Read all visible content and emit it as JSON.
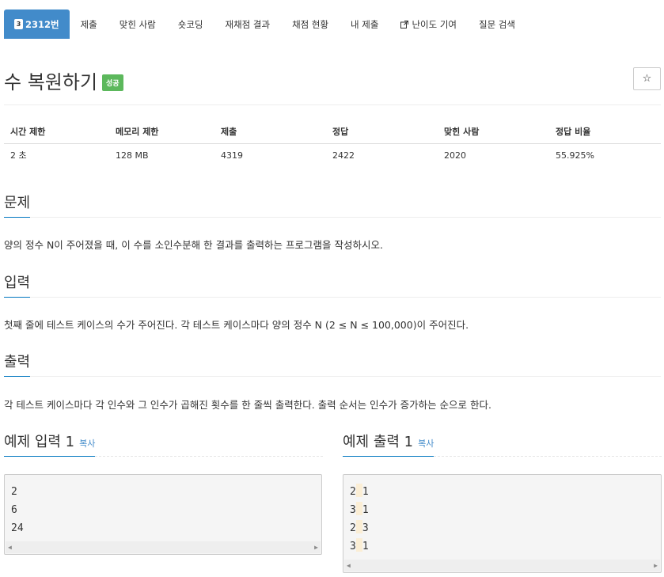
{
  "nav": {
    "problem_number": "2312번",
    "level_badge": "3",
    "tabs": [
      "제출",
      "맞힌 사람",
      "숏코딩",
      "재채점 결과",
      "채점 현황",
      "내 제출",
      "난이도 기여",
      "질문 검색"
    ]
  },
  "title": "수 복원하기",
  "status_badge": "성공",
  "star_label": "☆",
  "info": {
    "headers": [
      "시간 제한",
      "메모리 제한",
      "제출",
      "정답",
      "맞힌 사람",
      "정답 비율"
    ],
    "values": [
      "2 초",
      "128 MB",
      "4319",
      "2422",
      "2020",
      "55.925%"
    ]
  },
  "sections": {
    "problem": {
      "heading": "문제",
      "text": "양의 정수 N이 주어졌을 때, 이 수를 소인수분해 한 결과를 출력하는 프로그램을 작성하시오."
    },
    "input": {
      "heading": "입력",
      "text": "첫째 줄에 테스트 케이스의 수가 주어진다. 각 테스트 케이스마다 양의 정수 N (2 ≤ N ≤ 100,000)이 주어진다."
    },
    "output": {
      "heading": "출력",
      "text": "각 테스트 케이스마다 각 인수와 그 인수가 곱해진 횟수를 한 줄씩 출력한다. 출력 순서는 인수가 증가하는 순으로 한다."
    }
  },
  "samples": {
    "input": {
      "heading": "예제 입력 1",
      "copy": "복사",
      "lines": [
        "2",
        "6",
        "24"
      ]
    },
    "output": {
      "heading": "예제 출력 1",
      "copy": "복사",
      "rows": [
        [
          "2",
          "1"
        ],
        [
          "3",
          "1"
        ],
        [
          "2",
          "3"
        ],
        [
          "3",
          "1"
        ]
      ]
    }
  },
  "colors": {
    "accent": "#428bca",
    "success": "#5cb85c",
    "heading_underline": "#0076c0"
  }
}
